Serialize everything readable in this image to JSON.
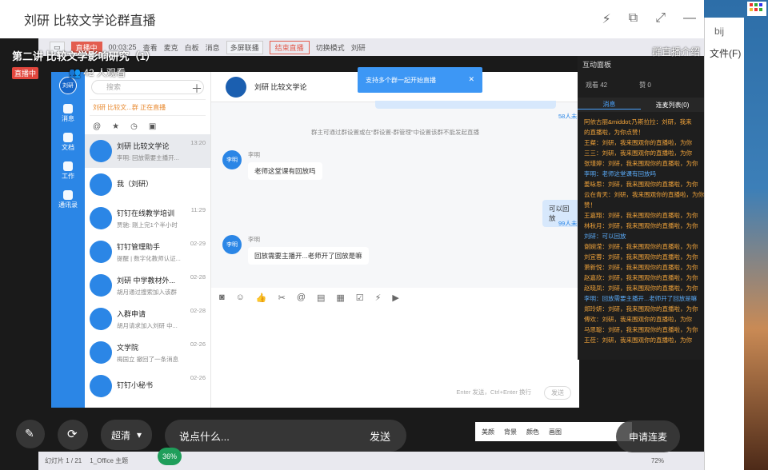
{
  "window": {
    "title": "刘研 比较文学论群直播"
  },
  "overlay": {
    "lecture_title": "第二讲 比较文学影响研究（1）",
    "live_badge": "直播中",
    "viewers": "42 人观看",
    "intro": "群直播介绍"
  },
  "ppt_toolbar": {
    "items": [
      "直播中",
      "00:03:25",
      "查看",
      "麦克",
      "白板",
      "消息",
      "多屏联播",
      "结束直播",
      "切换模式",
      "刘研"
    ]
  },
  "tooltip": {
    "text": "支持多个群一起开始直播"
  },
  "ding_sidebar": {
    "avatar": "刘研",
    "items": [
      "消息",
      "文档",
      "工作",
      "通讯录"
    ]
  },
  "conv_list": {
    "search_placeholder": "搜索",
    "banner": "刘研 比较文...群 正在直播",
    "items": [
      {
        "name": "刘研 比较文学论",
        "msg": "李明: 回放需要主播开...",
        "time": "13:20"
      },
      {
        "name": "我（刘研）",
        "msg": "",
        "time": ""
      },
      {
        "name": "钉钉在线教学培训",
        "msg": "贾驰: 刚上完1个半小时",
        "time": "11:29"
      },
      {
        "name": "钉钉管理助手",
        "msg": "提醒 | 数字化教师认证...",
        "time": "02-29"
      },
      {
        "name": "刘研 中学教材外...",
        "msg": "胡月通过搜索加入该群",
        "time": "02-28"
      },
      {
        "name": "入群申请",
        "msg": "胡月请求加入刘研 中...",
        "time": "02-28"
      },
      {
        "name": "文学院",
        "msg": "梅国立 撤回了一条消息",
        "time": "02-26"
      },
      {
        "name": "钉钉小秘书",
        "msg": "",
        "time": "02-26"
      }
    ]
  },
  "chat": {
    "title": "刘研 比较文学论",
    "notice": "群主可通过群设置或在“群设置-群管理”中设置该群不能发起直播",
    "read_top": "58人未",
    "messages": [
      {
        "sender": "李明",
        "avatar": "李明",
        "text": "老师这堂课有回放吗"
      },
      {
        "sender": "李明",
        "avatar": "李明",
        "text": "回放需要主播开...老师开了回放是嘛"
      }
    ],
    "reply": "可以回放",
    "reply_read": "99人未",
    "input_hint": "Enter 发送，Ctrl+Enter 换行",
    "send": "发送"
  },
  "panel": {
    "title": "互动面板",
    "viewers": "观看 42",
    "likes": "赞 0",
    "tab_msg": "消息",
    "tab_mic": "连麦列表(0)",
    "lines": [
      {
        "t": "阿依古丽&middot;乃斯拉拉：刘研，我来",
        "c": "y"
      },
      {
        "t": "的直播啦，为你点赞！",
        "c": "y"
      },
      {
        "t": "王粲：刘研，我来围观你的直播啦，为你",
        "c": "y"
      },
      {
        "t": "三三：刘研，我来围观你的直播啦，为你",
        "c": "y"
      },
      {
        "t": "张瑾婷：刘研，我来围观你的直播啦，为你",
        "c": "y"
      },
      {
        "t": "李明：老师这堂课有回放吗",
        "c": "b"
      },
      {
        "t": "姜咏思：刘研，我来围观你的直播啦，为你",
        "c": "y"
      },
      {
        "t": "云在青天：刘研，我来围观你的直播啦，为你",
        "c": "y"
      },
      {
        "t": "赞！",
        "c": "y"
      },
      {
        "t": "王嘉翔：刘研，我来围观你的直播啦，为你",
        "c": "y"
      },
      {
        "t": "林秋月：刘研，我来围观你的直播啦，为你",
        "c": "y"
      },
      {
        "t": "刘研：可以回放",
        "c": "b"
      },
      {
        "t": "谢婉滢：刘研，我来围观你的直播啦，为你",
        "c": "y"
      },
      {
        "t": "刘宜蓉：刘研，我来围观你的直播啦，为你",
        "c": "y"
      },
      {
        "t": "萧新悦：刘研，我来围观你的直播啦，为你",
        "c": "y"
      },
      {
        "t": "赵嘉欣：刘研，我来围观你的直播啦，为你",
        "c": "y"
      },
      {
        "t": "赵晓凤：刘研，我来围观你的直播啦，为你",
        "c": "y"
      },
      {
        "t": "李明：回放需要主播开...老师开了回放是嘛",
        "c": "b"
      },
      {
        "t": "郑玲妍：刘研，我来围观你的直播啦，为你",
        "c": "y"
      },
      {
        "t": "傅欢：刘研，我来围观你的直播啦，为你",
        "c": "y"
      },
      {
        "t": "马思聪：刘研，我来围观你的直播啦，为你",
        "c": "y"
      },
      {
        "t": "王莅：刘研，我来围观你的直播啦，为你",
        "c": "y"
      }
    ]
  },
  "bottom": {
    "quality": "超清",
    "comment_placeholder": "说点什么...",
    "send": "发送",
    "apply_mic": "申请连麦",
    "cpu": "36%",
    "slide_info": "幻灯片 1 / 21",
    "theme": "1_Office 主题",
    "zoom": "72%",
    "beauty": "美颜",
    "background": "背景",
    "color": "颜色",
    "paint": "画图"
  },
  "right_window": {
    "t1": "bij",
    "t2": "文件(F)"
  }
}
